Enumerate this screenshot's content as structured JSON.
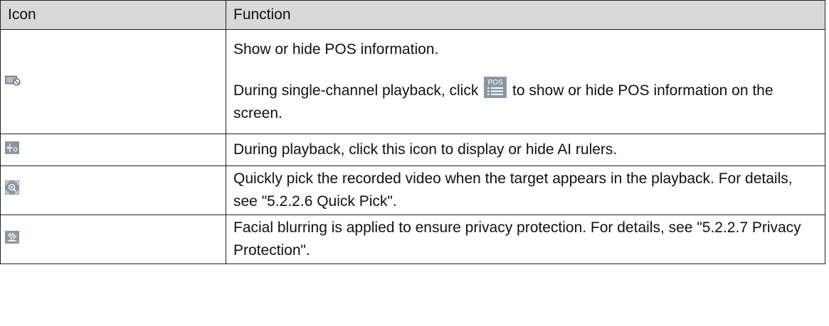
{
  "table": {
    "headers": {
      "icon": "Icon",
      "function": "Function"
    },
    "rows": [
      {
        "icon": "pos-hide-icon",
        "lines": [
          "Show or hide POS information.",
          "During single-channel playback, click",
          "to show or hide POS information on the screen."
        ],
        "inline_icon": "pos-list-icon",
        "inline_icon_text": "POS"
      },
      {
        "icon": "ai-ruler-icon",
        "text": "During playback, click this icon to display or hide AI rulers."
      },
      {
        "icon": "quick-pick-icon",
        "text": "Quickly pick the recorded video when the target appears in the playback. For details, see \"5.2.2.6 Quick Pick\"."
      },
      {
        "icon": "privacy-blur-icon",
        "text": "Facial blurring is applied to ensure privacy protection. For details, see \"5.2.2.7 Privacy Protection\"."
      }
    ]
  }
}
